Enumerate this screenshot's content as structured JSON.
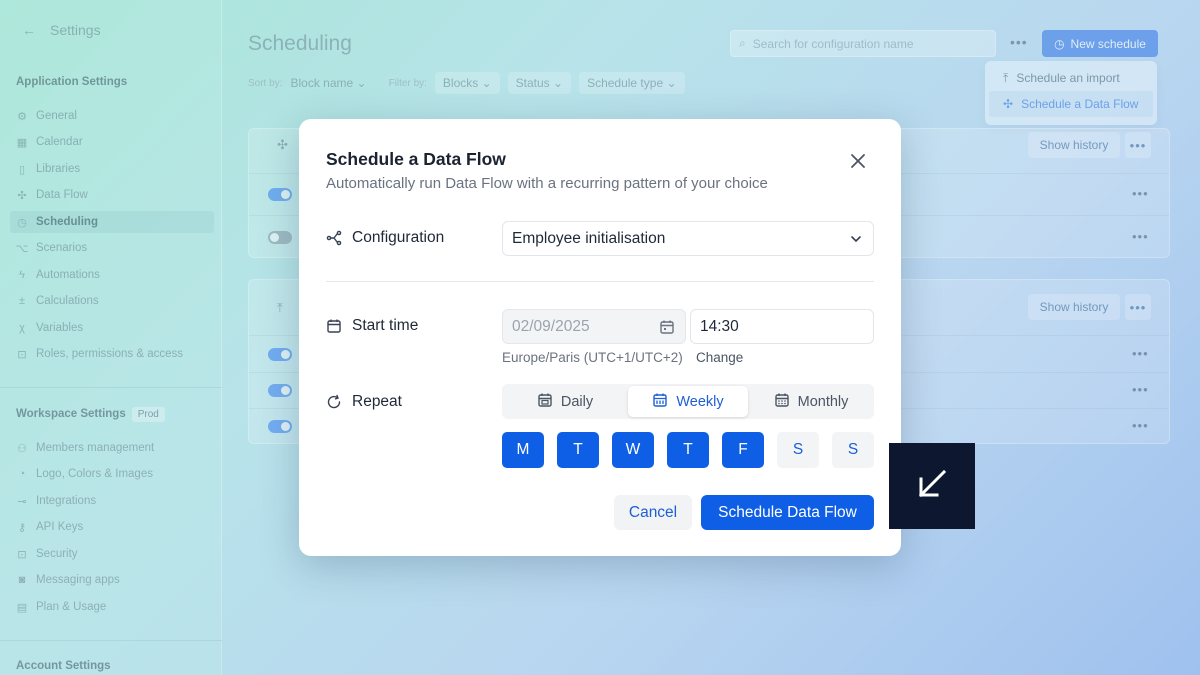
{
  "sidebar": {
    "back_label": "Settings",
    "app_section": "Application Settings",
    "app_items": [
      {
        "label": "General",
        "icon": "gear-icon"
      },
      {
        "label": "Calendar",
        "icon": "calendar-icon"
      },
      {
        "label": "Libraries",
        "icon": "book-icon"
      },
      {
        "label": "Data Flow",
        "icon": "data-flow-icon"
      },
      {
        "label": "Scheduling",
        "icon": "timer-icon",
        "active": true
      },
      {
        "label": "Scenarios",
        "icon": "branch-icon"
      },
      {
        "label": "Automations",
        "icon": "lightning-icon"
      },
      {
        "label": "Calculations",
        "icon": "calculator-icon"
      },
      {
        "label": "Variables",
        "icon": "variable-icon"
      },
      {
        "label": "Roles, permissions & access",
        "icon": "lock-icon"
      }
    ],
    "workspace_section": "Workspace Settings",
    "workspace_badge": "Prod",
    "workspace_items": [
      {
        "label": "Members management",
        "icon": "users-icon"
      },
      {
        "label": "Logo, Colors & Images",
        "icon": "palette-icon"
      },
      {
        "label": "Integrations",
        "icon": "plug-icon"
      },
      {
        "label": "API Keys",
        "icon": "key-icon"
      },
      {
        "label": "Security",
        "icon": "lock-icon"
      },
      {
        "label": "Messaging apps",
        "icon": "chat-icon"
      },
      {
        "label": "Plan & Usage",
        "icon": "document-icon"
      }
    ],
    "account_section": "Account Settings"
  },
  "main": {
    "title": "Scheduling",
    "sort_label": "Sort by:",
    "sort_value": "Block name",
    "filter_label": "Filter by:",
    "filters": [
      "Blocks",
      "Status",
      "Schedule type"
    ],
    "search_placeholder": "Search for configuration name",
    "new_schedule": "New schedule",
    "dropdown": [
      "Schedule an import",
      "Schedule a Data Flow"
    ],
    "show_history": "Show history"
  },
  "modal": {
    "title": "Schedule a Data Flow",
    "subtitle": "Automatically run Data Flow with a recurring pattern of your choice",
    "configuration_label": "Configuration",
    "configuration_value": "Employee initialisation",
    "start_time_label": "Start time",
    "date_value": "02/09/2025",
    "time_value": "14:30",
    "timezone": "Europe/Paris (UTC+1/UTC+2)",
    "timezone_change": "Change",
    "repeat_label": "Repeat",
    "repeat_options": [
      "Daily",
      "Weekly",
      "Monthly"
    ],
    "repeat_selected": "Weekly",
    "days": [
      {
        "label": "M",
        "selected": true
      },
      {
        "label": "T",
        "selected": true
      },
      {
        "label": "W",
        "selected": true
      },
      {
        "label": "T",
        "selected": true
      },
      {
        "label": "F",
        "selected": true
      },
      {
        "label": "S",
        "selected": false
      },
      {
        "label": "S",
        "selected": false
      }
    ],
    "cancel": "Cancel",
    "submit": "Schedule Data Flow"
  },
  "colors": {
    "primary": "#0f5fe6",
    "corner_badge": "#0d1830"
  }
}
